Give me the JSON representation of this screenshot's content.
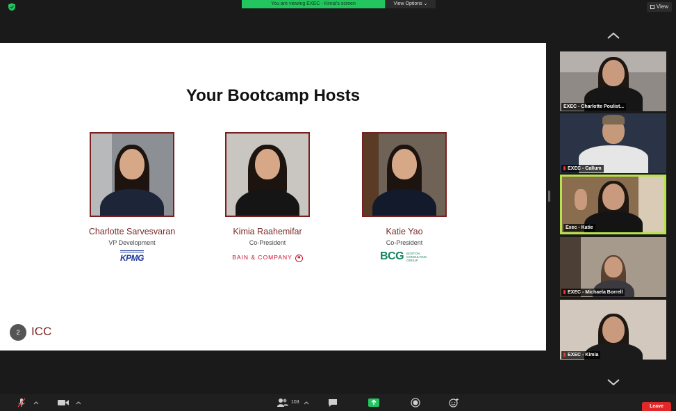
{
  "window": {
    "banner_text": "You are viewing EXEC - Kimia's screen",
    "view_options_label": "View Options ⌄",
    "view_button_label": "View"
  },
  "slide": {
    "title": "Your Bootcamp Hosts",
    "page_number": "2",
    "brand": "ICC",
    "hosts": [
      {
        "name": "Charlotte Sarvesvaran",
        "role": "VP Development",
        "logo": "KPMG",
        "colors": {
          "bg": "#8c8f93",
          "body": "#1c2638"
        }
      },
      {
        "name": "Kimia Raahemifar",
        "role": "Co-President",
        "logo": "BAIN & COMPANY",
        "colors": {
          "bg": "#c9c6c2",
          "body": "#151515"
        }
      },
      {
        "name": "Katie Yao",
        "role": "Co-President",
        "logo": "BCG",
        "logo_sub": "BOSTON CONSULTING GROUP",
        "colors": {
          "bg": "#6e6356",
          "body": "#121a2c"
        }
      }
    ]
  },
  "gallery": {
    "participants": [
      {
        "label": "EXEC - Charlotte Poulist...",
        "muted": false,
        "active": false
      },
      {
        "label": "EXEC - Callum",
        "muted": true,
        "active": false
      },
      {
        "label": "Exec - Katie",
        "muted": false,
        "active": true
      },
      {
        "label": "EXEC - Michaela Borrell",
        "muted": true,
        "active": false
      },
      {
        "label": "EXEC - Kimia",
        "muted": true,
        "active": false
      }
    ]
  },
  "toolbar": {
    "participant_count": "103",
    "leave_label": "Leave",
    "icons": [
      "mic-muted-icon",
      "video-camera-icon",
      "participants-icon",
      "chat-icon",
      "share-screen-icon",
      "record-icon",
      "reactions-icon"
    ]
  },
  "colors": {
    "banner_green": "#22c55e",
    "active_speaker_border": "#b7e34a",
    "leave_red": "#e02828",
    "brand_maroon": "#7a1f1f",
    "toolbar_share_green": "#22c55e"
  }
}
